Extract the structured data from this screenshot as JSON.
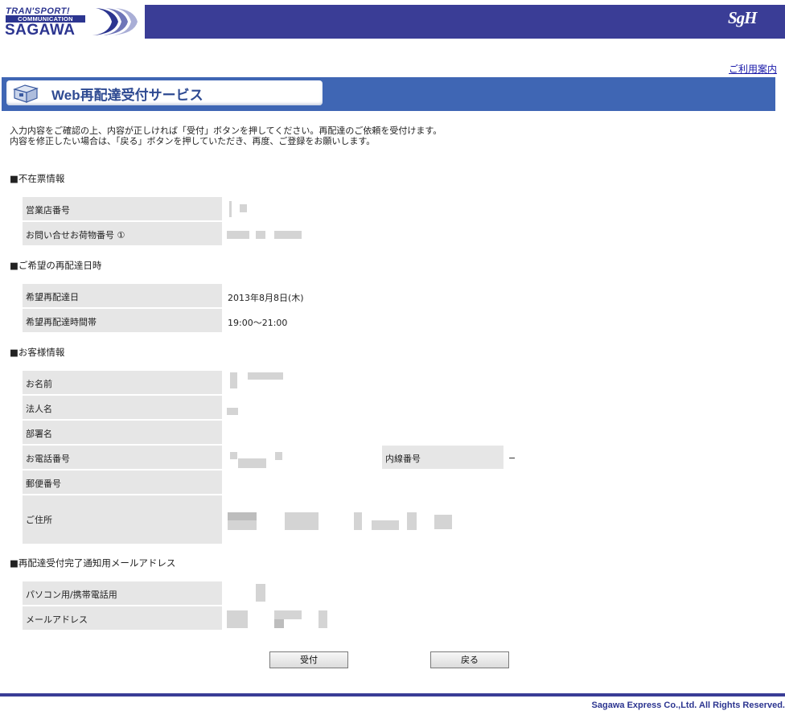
{
  "header": {
    "logo_line1": "TRAN'SPORT!",
    "logo_line2": "COMMUNICATION",
    "logo_line3": "SAGAWA",
    "right_logo": "SgH",
    "guide_link": "ご利用案内"
  },
  "banner": {
    "title": "Web再配達受付サービス",
    "icon": "package-box-icon"
  },
  "intro": {
    "line1": "入力内容をご確認の上、内容が正しければ「受付」ボタンを押してください。再配達のご依頼を受付けます。",
    "line2": "内容を修正したい場合は、「戻る」ボタンを押していただき、再度、ご登録をお願いします。"
  },
  "sections": {
    "absence": {
      "title": "■不在票情報",
      "office_label": "営業店番号",
      "tracking_label": "お問い合せお荷物番号 ①"
    },
    "redelivery": {
      "title": "■ご希望の再配達日時",
      "date_label": "希望再配達日",
      "date_value": "2013年8月8日(木)",
      "time_label": "希望再配達時間帯",
      "time_value": "19:00〜21:00"
    },
    "customer": {
      "title": "■お客様情報",
      "name_label": "お名前",
      "company_label": "法人名",
      "department_label": "部署名",
      "phone_label": "お電話番号",
      "extension_label": "内線番号",
      "extension_value": "−",
      "postal_label": "郵便番号",
      "address_label": "ご住所"
    },
    "email": {
      "title": "■再配達受付完了通知用メールアドレス",
      "device_label": "パソコン用/携帯電話用",
      "address_label": "メールアドレス"
    }
  },
  "buttons": {
    "accept": "受付",
    "back": "戻る"
  },
  "footer": {
    "copyright": "Sagawa Express Co.,Ltd. All Rights Reserved."
  }
}
